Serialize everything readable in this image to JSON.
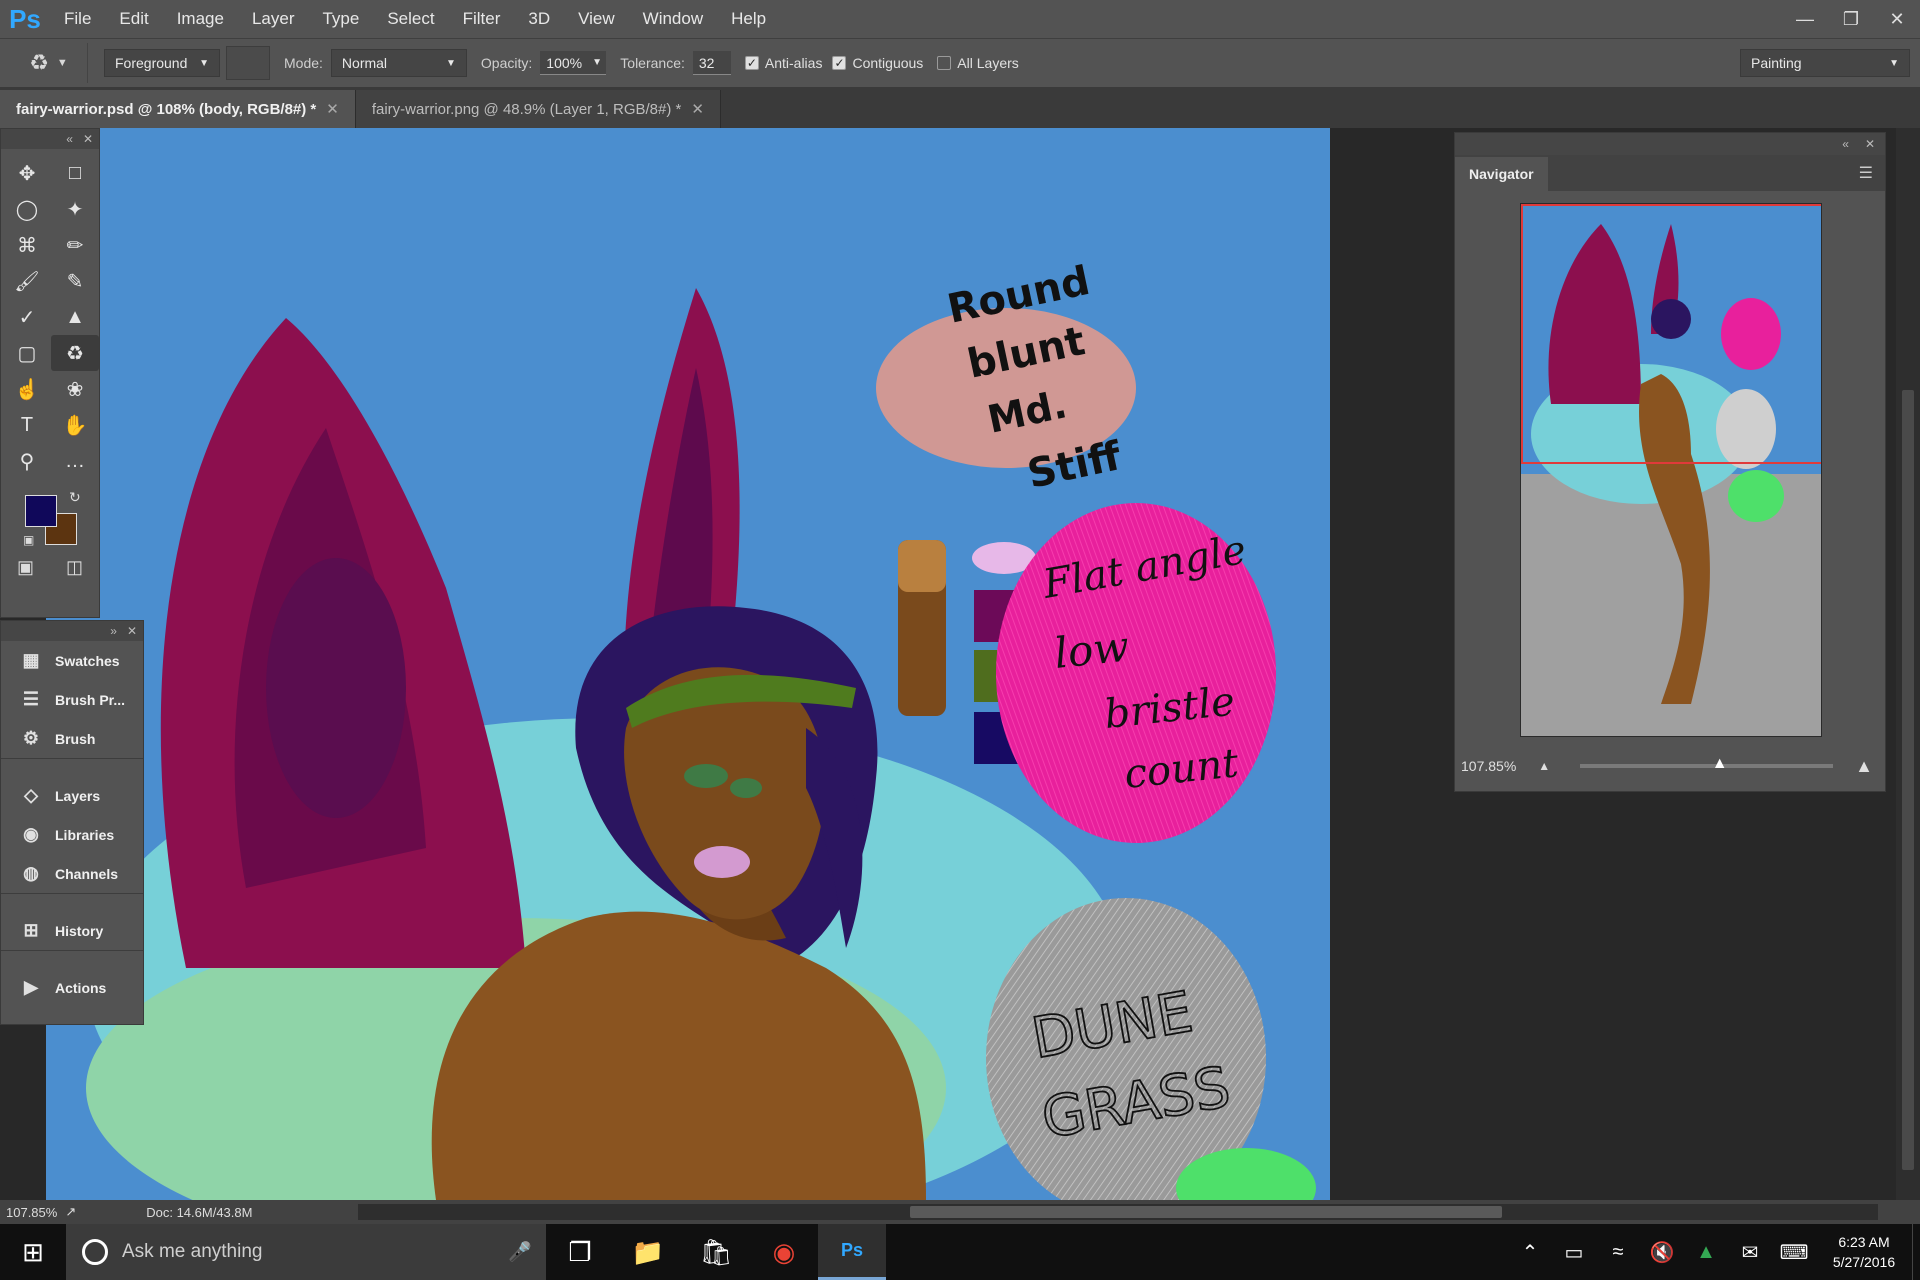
{
  "app": {
    "logo": "Ps"
  },
  "menu": [
    "File",
    "Edit",
    "Image",
    "Layer",
    "Type",
    "Select",
    "Filter",
    "3D",
    "View",
    "Window",
    "Help"
  ],
  "window_controls": [
    "minimize-icon",
    "restore-icon",
    "close-icon"
  ],
  "options": {
    "tool_icon": "paint-bucket-icon",
    "source": "Foreground",
    "mode_label": "Mode:",
    "mode_value": "Normal",
    "opacity_label": "Opacity:",
    "opacity_value": "100%",
    "tolerance_label": "Tolerance:",
    "tolerance_value": "32",
    "anti_alias": "Anti-alias",
    "contiguous": "Contiguous",
    "all_layers": "All Layers",
    "workspace": "Painting"
  },
  "tabs": [
    {
      "label": "fairy-warrior.psd @ 108% (body, RGB/8#) *",
      "active": true
    },
    {
      "label": "fairy-warrior.png @ 48.9% (Layer 1, RGB/8#) *",
      "active": false
    }
  ],
  "tools": [
    "move-icon",
    "marquee-icon",
    "lasso-icon",
    "magic-wand-icon",
    "crop-icon",
    "eyedropper-icon",
    "brush-icon",
    "pencil-icon",
    "mixer-brush-icon",
    "clone-stamp-icon",
    "eraser-icon",
    "paint-bucket-icon",
    "smudge-icon",
    "sponge-icon",
    "type-icon",
    "hand-icon",
    "zoom-icon",
    "more-icon"
  ],
  "colors": {
    "foreground": "#10085a",
    "background": "#5c3410"
  },
  "panels": [
    "Swatches",
    "Brush Pr...",
    "Brush",
    "Layers",
    "Libraries",
    "Channels",
    "History",
    "Actions"
  ],
  "canvas_notes": {
    "round": "Round",
    "blunt": "blunt",
    "md": "Md.",
    "stiff": "Stiff",
    "flat": "Flat angle",
    "low": "low",
    "bristle": "bristle",
    "count": "count",
    "dune": "DUNE",
    "grass": "GRASS"
  },
  "navigator": {
    "title": "Navigator",
    "zoom": "107.85%"
  },
  "status": {
    "zoom": "107.85%",
    "doc": "Doc: 14.6M/43.8M"
  },
  "taskbar": {
    "search_placeholder": "Ask me anything",
    "time": "6:23 AM",
    "date": "5/27/2016"
  }
}
